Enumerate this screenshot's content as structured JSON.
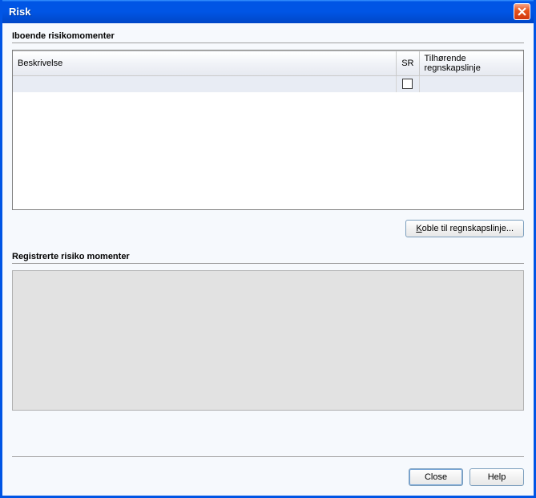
{
  "window": {
    "title": "Risk"
  },
  "section1": {
    "label": "Iboende risikomomenter",
    "columns": {
      "beskrivelse": "Beskrivelse",
      "sr": "SR",
      "regnskap": "Tilhørende regnskapslinje"
    },
    "rows": [
      {
        "beskrivelse": "",
        "sr": false,
        "regnskap": ""
      }
    ],
    "link_button_prefix": "K",
    "link_button_rest": "oble til regnskapslinje..."
  },
  "section2": {
    "label": "Registrerte risiko momenter"
  },
  "footer": {
    "close": "Close",
    "help": "Help"
  }
}
